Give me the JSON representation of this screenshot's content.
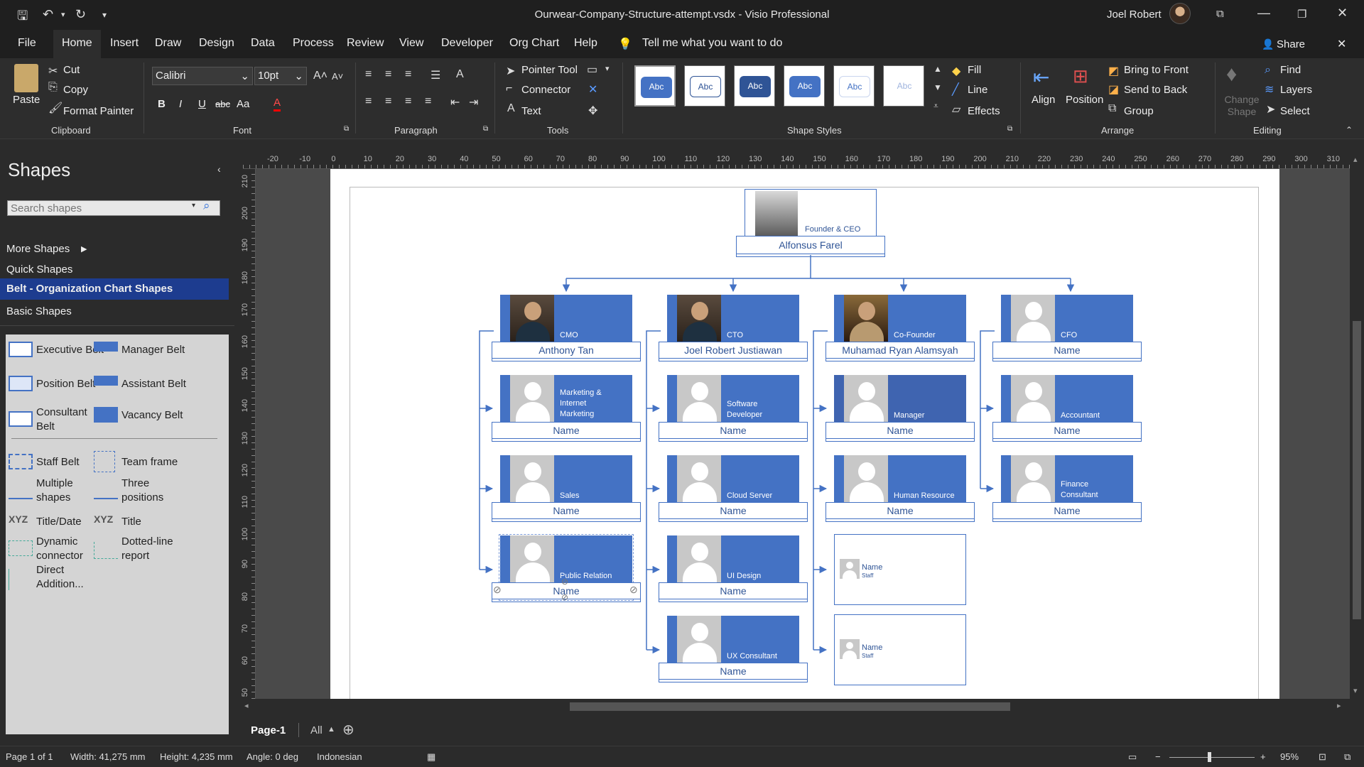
{
  "window": {
    "title": "Ourwear-Company-Structure-attempt.vsdx  -  Visio Professional",
    "user": "Joel Robert"
  },
  "menu": {
    "file": "File",
    "home": "Home",
    "insert": "Insert",
    "draw": "Draw",
    "design": "Design",
    "data": "Data",
    "process": "Process",
    "review": "Review",
    "view": "View",
    "developer": "Developer",
    "org_chart": "Org Chart",
    "help": "Help",
    "tell_me": "Tell me what you want to do",
    "share": "Share"
  },
  "ribbon": {
    "clipboard": {
      "paste": "Paste",
      "cut": "Cut",
      "copy": "Copy",
      "format_painter": "Format Painter",
      "label": "Clipboard"
    },
    "font": {
      "family": "Calibri",
      "size": "10pt",
      "label": "Font",
      "bold": "B",
      "italic": "I",
      "underline": "U",
      "strike": "abc",
      "case": "Aa",
      "color": "A"
    },
    "paragraph": {
      "label": "Paragraph"
    },
    "tools": {
      "pointer": "Pointer Tool",
      "connector": "Connector",
      "text": "Text",
      "label": "Tools"
    },
    "shape_styles": {
      "label": "Shape Styles",
      "sample": "Abc",
      "fill": "Fill",
      "line": "Line",
      "effects": "Effects"
    },
    "arrange": {
      "align": "Align",
      "position": "Position",
      "bring_front": "Bring to Front",
      "send_back": "Send to Back",
      "group": "Group",
      "label": "Arrange"
    },
    "editing": {
      "change_shape": "Change Shape",
      "find": "Find",
      "layers": "Layers",
      "select": "Select",
      "label": "Editing"
    }
  },
  "shapes_pane": {
    "heading": "Shapes",
    "search_placeholder": "Search shapes",
    "more_shapes": "More Shapes",
    "quick_shapes": "Quick Shapes",
    "belt": "Belt - Organization Chart Shapes",
    "basic": "Basic Shapes",
    "stencil": {
      "executive": "Executive Belt",
      "manager": "Manager Belt",
      "position": "Position Belt",
      "assistant": "Assistant Belt",
      "consultant_1": "Consultant",
      "consultant_2": "Belt",
      "vacancy": "Vacancy Belt",
      "staff": "Staff Belt",
      "team_frame": "Team frame",
      "multiple_1": "Multiple",
      "multiple_2": "shapes",
      "three_1": "Three",
      "three_2": "positions",
      "title_date": "Title/Date",
      "title": "Title",
      "dynamic_1": "Dynamic",
      "dynamic_2": "connector",
      "dotted_1": "Dotted-line",
      "dotted_2": "report",
      "direct_1": "Direct",
      "direct_2": "Addition..."
    }
  },
  "rulers": {
    "h": [
      "-20",
      "-10",
      "0",
      "10",
      "20",
      "30",
      "40",
      "50",
      "60",
      "70",
      "80",
      "90",
      "100",
      "110",
      "120",
      "130",
      "140",
      "150",
      "160",
      "170",
      "180",
      "190",
      "200",
      "210",
      "220",
      "230",
      "240",
      "250",
      "260",
      "270",
      "280",
      "290",
      "300",
      "310"
    ],
    "v": [
      "210",
      "200",
      "190",
      "180",
      "170",
      "160",
      "150",
      "140",
      "130",
      "120",
      "110",
      "100",
      "90",
      "80",
      "70",
      "60",
      "50"
    ]
  },
  "org": {
    "ceo": {
      "role": "Founder & CEO",
      "name": "Alfonsus Farel"
    },
    "cmo": {
      "role": "CMO",
      "name": "Anthony Tan"
    },
    "cto": {
      "role": "CTO",
      "name": "Joel Robert Justiawan"
    },
    "cofounder": {
      "role": "Co-Founder",
      "name": "Muhamad Ryan Alamsyah"
    },
    "cfo": {
      "role": "CFO",
      "name": "Name"
    },
    "marketing": {
      "role_1": "Marketing &",
      "role_2": "Internet",
      "role_3": "Marketing",
      "name": "Name"
    },
    "sales": {
      "role": "Sales",
      "name": "Name"
    },
    "pr": {
      "role": "Public Relation",
      "name": "Name"
    },
    "software": {
      "role_1": "Software",
      "role_2": "Developer",
      "name": "Name"
    },
    "cloud": {
      "role": "Cloud Server",
      "name": "Name"
    },
    "ui": {
      "role": "UI Design",
      "name": "Name"
    },
    "ux": {
      "role": "UX Consultant",
      "name": "Name"
    },
    "manager": {
      "role": "Manager",
      "name": "Name"
    },
    "hr": {
      "role": "Human Resource",
      "name": "Name"
    },
    "accountant": {
      "role": "Accountant",
      "name": "Name"
    },
    "finance": {
      "role_1": "Finance",
      "role_2": "Consultant",
      "name": "Name"
    },
    "staff1": {
      "name": "Name",
      "sub": "Staff"
    },
    "staff2": {
      "name": "Name",
      "sub": "Staff"
    }
  },
  "tabs": {
    "page1": "Page-1",
    "all": "All"
  },
  "status": {
    "page": "Page 1 of 1",
    "width": "Width: 41,275 mm",
    "height": "Height: 4,235 mm",
    "angle": "Angle: 0 deg",
    "language": "Indonesian",
    "zoom": "95%"
  },
  "colors": {
    "accent": "#4472c4",
    "menu_bg": "#1f1f1f",
    "ribbon_bg": "#2d2d2d",
    "selected_stencil": "#1d3c8f"
  }
}
